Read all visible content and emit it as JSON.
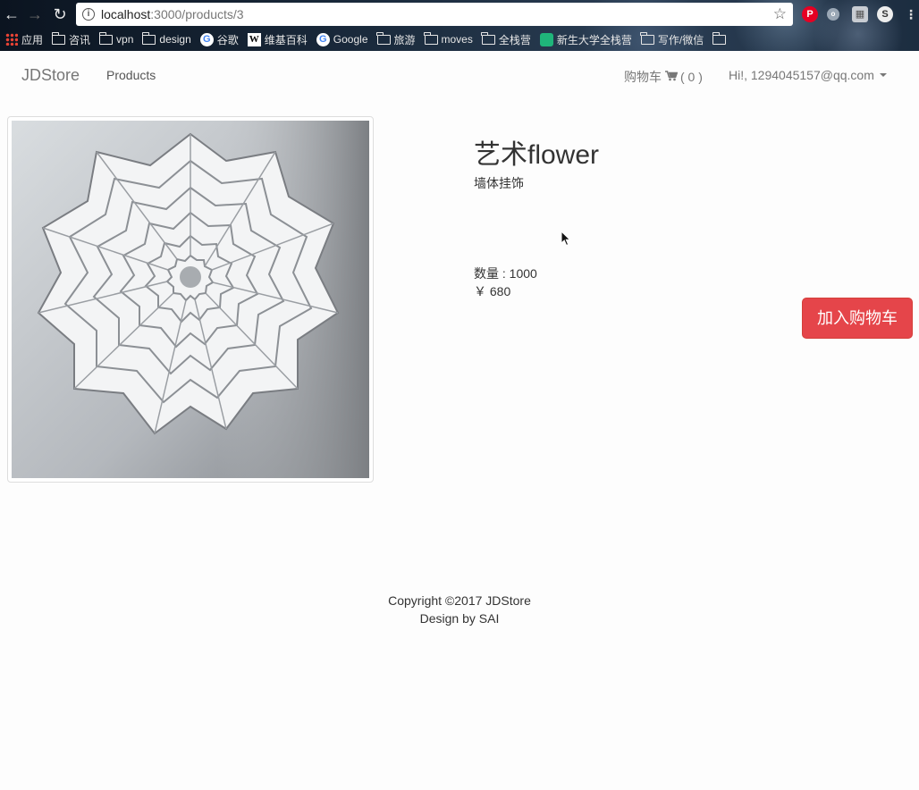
{
  "browser": {
    "url_host": "localhost",
    "url_path": ":3000/products/3",
    "bookmarks": [
      {
        "icon": "apps-icon",
        "label": "应用"
      },
      {
        "icon": "folder-icon",
        "label": "咨讯"
      },
      {
        "icon": "folder-icon",
        "label": "vpn"
      },
      {
        "icon": "folder-icon",
        "label": "design"
      },
      {
        "icon": "g-icon",
        "label": "谷歌"
      },
      {
        "icon": "w-icon",
        "label": "维基百科"
      },
      {
        "icon": "g-icon",
        "label": "Google"
      },
      {
        "icon": "folder-icon",
        "label": "旅游"
      },
      {
        "icon": "folder-icon",
        "label": "moves"
      },
      {
        "icon": "folder-icon",
        "label": "全栈营"
      },
      {
        "icon": "leaf-icon",
        "label": "新生大学全栈营"
      },
      {
        "icon": "folder-icon",
        "label": "写作/微信"
      },
      {
        "icon": "folder-icon",
        "label": ""
      }
    ]
  },
  "navbar": {
    "brand": "JDStore",
    "products_link": "Products",
    "cart_label": "购物车",
    "cart_count": "( 0 )",
    "user_greeting": "Hi!, 1294045157@qq.com"
  },
  "product": {
    "title": "艺术flower",
    "description": "墙体挂饰",
    "quantity": "数量 : 1000",
    "price": "￥ 680",
    "add_to_cart": "加入购物车"
  },
  "footer": {
    "copyright": "Copyright ©2017 JDStore",
    "credit": "Design by SAI"
  },
  "colors": {
    "accent_button": "#e5454a",
    "brand_text": "#777777"
  }
}
